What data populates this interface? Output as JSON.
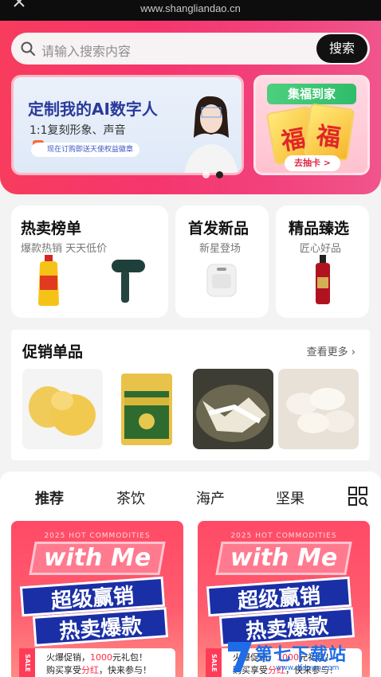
{
  "browser": {
    "url": "www.shangliandao.cn"
  },
  "search": {
    "placeholder": "请输入搜索内容",
    "button": "搜索"
  },
  "banners": {
    "main_title": "定制我的AI数字人",
    "main_subtitle": "1:1复刻形象、声音",
    "main_note": "现在订购即送天使权益徽章",
    "side_title": "集福到家",
    "side_card_char": "福",
    "side_button": "去抽卡 >",
    "carousel_active_index": 2,
    "carousel_count": 2
  },
  "categories": [
    {
      "title": "热卖榜单",
      "subtitle": "爆款热销 天天低价"
    },
    {
      "title": "首发新品",
      "subtitle": "新星登场"
    },
    {
      "title": "精品臻选",
      "subtitle": "匠心好品"
    }
  ],
  "promo": {
    "title": "促销单品",
    "more": "查看更多"
  },
  "feed": {
    "tabs": [
      "推荐",
      "茶饮",
      "海产",
      "坚果"
    ],
    "cards": [
      {
        "tag": "2025 HOT COMMODITIES",
        "headline": "with Me",
        "line1": "超级赢销",
        "line2": "热卖爆款",
        "sale": "SALE",
        "note1_a": "火爆促销，",
        "note1_b": "1000",
        "note1_c": "元礼包！",
        "note2_a": "购买享受",
        "note2_b": "分红",
        "note2_c": "，快来参与！"
      },
      {
        "tag": "2025 HOT COMMODITIES",
        "headline": "with Me",
        "line1": "超级赢销",
        "line2": "热卖爆款",
        "sale": "SALE",
        "note1_a": "火爆促销，",
        "note1_b": "1000",
        "note1_c": "元礼包！",
        "note2_a": "购买享受",
        "note2_b": "分红",
        "note2_c": "，快来参与！"
      }
    ]
  },
  "watermark": {
    "text": "第七下载站",
    "url": "www.dfdown.com"
  },
  "colors": {
    "accent": "#f5366d",
    "dark_button": "#111111",
    "watermark": "#1f6de6"
  }
}
